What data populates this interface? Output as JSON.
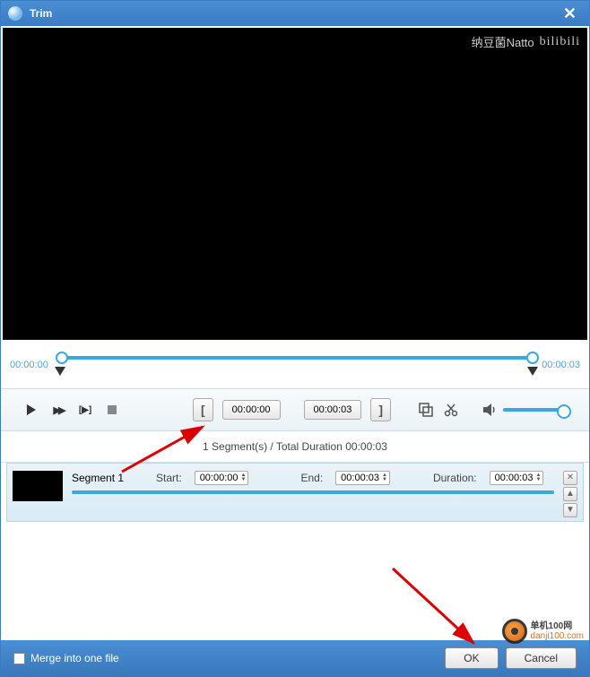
{
  "window": {
    "title": "Trim"
  },
  "video_watermark": {
    "text": "纳豆菌Natto",
    "brand": "bilibili"
  },
  "timeline": {
    "start": "00:00:00",
    "end": "00:00:03"
  },
  "controls": {
    "in_time": "00:00:00",
    "out_time": "00:00:03",
    "left_bracket": "[",
    "right_bracket": "]"
  },
  "summary_text": "1 Segment(s) / Total Duration 00:00:03",
  "segment": {
    "name": "Segment 1",
    "start_label": "Start:",
    "start_value": "00:00:00",
    "end_label": "End:",
    "end_value": "00:00:03",
    "duration_label": "Duration:",
    "duration_value": "00:00:03"
  },
  "footer": {
    "merge_label": "Merge into one file",
    "ok": "OK",
    "cancel": "Cancel"
  },
  "site_watermark": {
    "cn": "单机100网",
    "url": "danji100.com"
  }
}
